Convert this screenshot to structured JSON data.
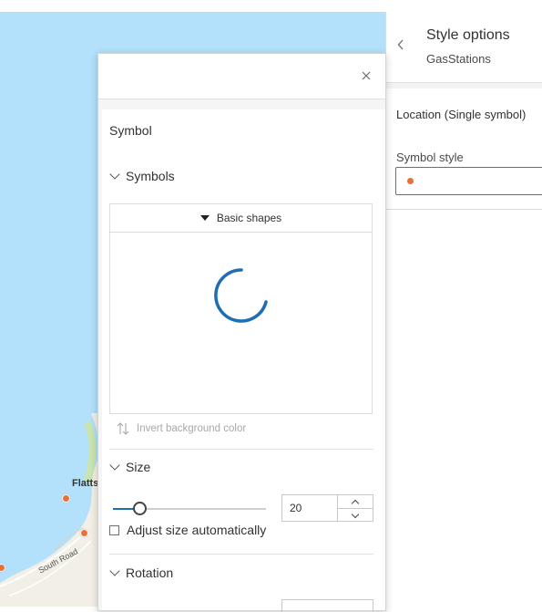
{
  "style_panel": {
    "title": "Style options",
    "subtitle": "GasStations",
    "section_label": "Location (Single symbol)",
    "symbol_style_label": "Symbol style"
  },
  "popover": {
    "title": "Symbol",
    "symbols_section": {
      "label": "Symbols",
      "gallery_category": "Basic shapes",
      "invert_label": "Invert background color"
    },
    "size_section": {
      "label": "Size",
      "value": "20",
      "slider_fraction": 0.17,
      "adjust_label": "Adjust size automatically",
      "adjust_checked": false
    },
    "rotation_section": {
      "label": "Rotation"
    }
  },
  "map": {
    "place_label": "Flatts",
    "road_label": "South Road"
  },
  "colors": {
    "water": "#b3e0fb",
    "poi": "#e8703a",
    "accent": "#1f6db3"
  },
  "icons": {
    "back": "chevron-left-icon",
    "close": "close-icon",
    "section": "chevron-down-icon",
    "gallery": "caret-down-icon",
    "loading": "spinner-icon",
    "invert": "invert-arrows-icon"
  }
}
